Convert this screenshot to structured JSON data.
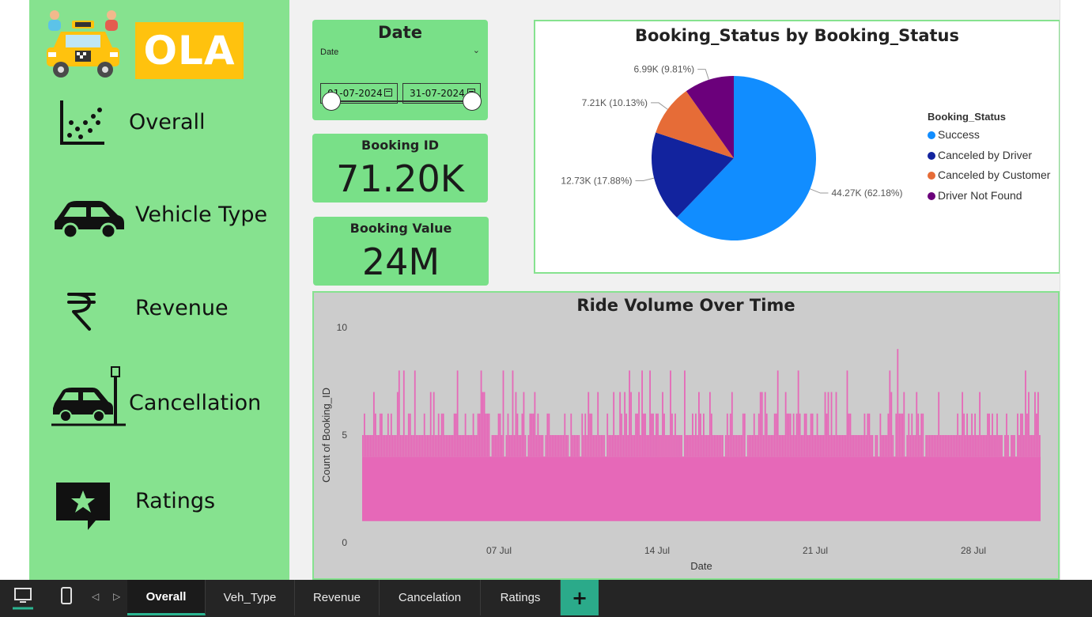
{
  "brand": {
    "logo_text": "OLA"
  },
  "sidebar": {
    "items": [
      {
        "label": "Overall",
        "icon": "scatter-chart-icon"
      },
      {
        "label": "Vehicle Type",
        "icon": "car-icon"
      },
      {
        "label": "Revenue",
        "icon": "rupee-icon"
      },
      {
        "label": "Cancellation",
        "icon": "car-crash-icon"
      },
      {
        "label": "Ratings",
        "icon": "star-review-icon"
      }
    ]
  },
  "date_slicer": {
    "title": "Date",
    "field_label": "Date",
    "start": "01-07-2024",
    "end": "31-07-2024"
  },
  "kpis": {
    "booking_id": {
      "label": "Booking ID",
      "value": "71.20K"
    },
    "booking_value": {
      "label": "Booking Value",
      "value": "24M"
    }
  },
  "pie": {
    "title": "Booking_Status by Booking_Status",
    "legend_title": "Booking_Status",
    "colors": {
      "success": "#118dff",
      "canceled_driver": "#12239e",
      "canceled_customer": "#e66c37",
      "not_found": "#6b007b"
    }
  },
  "chart_data": [
    {
      "type": "pie",
      "title": "Booking_Status by Booking_Status",
      "legend_title": "Booking_Status",
      "legend_position": "right",
      "categories": [
        "Success",
        "Canceled by Driver",
        "Canceled by Customer",
        "Driver Not Found"
      ],
      "values": [
        44.27,
        12.73,
        7.21,
        6.99
      ],
      "value_unit": "K",
      "labels": [
        "44.27K (62.18%)",
        "12.73K (17.88%)",
        "7.21K (10.13%)",
        "6.99K (9.81%)"
      ],
      "percents": [
        62.18,
        17.88,
        10.13,
        9.81
      ]
    },
    {
      "type": "bar",
      "title": "Ride Volume Over Time",
      "xlabel": "Date",
      "ylabel": "Count of Booking_ID",
      "ylim": [
        0,
        10
      ],
      "yticks": [
        "0",
        "5",
        "10"
      ],
      "xticks": [
        "07 Jul",
        "14 Jul",
        "21 Jul",
        "28 Jul"
      ],
      "x_range": [
        "01 Jul",
        "31 Jul"
      ],
      "color": "#e668b8",
      "series": [
        {
          "typical_range": [
            1,
            6
          ],
          "peak_values": [
            8,
            9
          ]
        }
      ],
      "grid": false
    }
  ],
  "pages": {
    "tabs": [
      "Overall",
      "Veh_Type",
      "Revenue",
      "Cancelation",
      "Ratings"
    ],
    "active": "Overall",
    "add_label": "+"
  }
}
